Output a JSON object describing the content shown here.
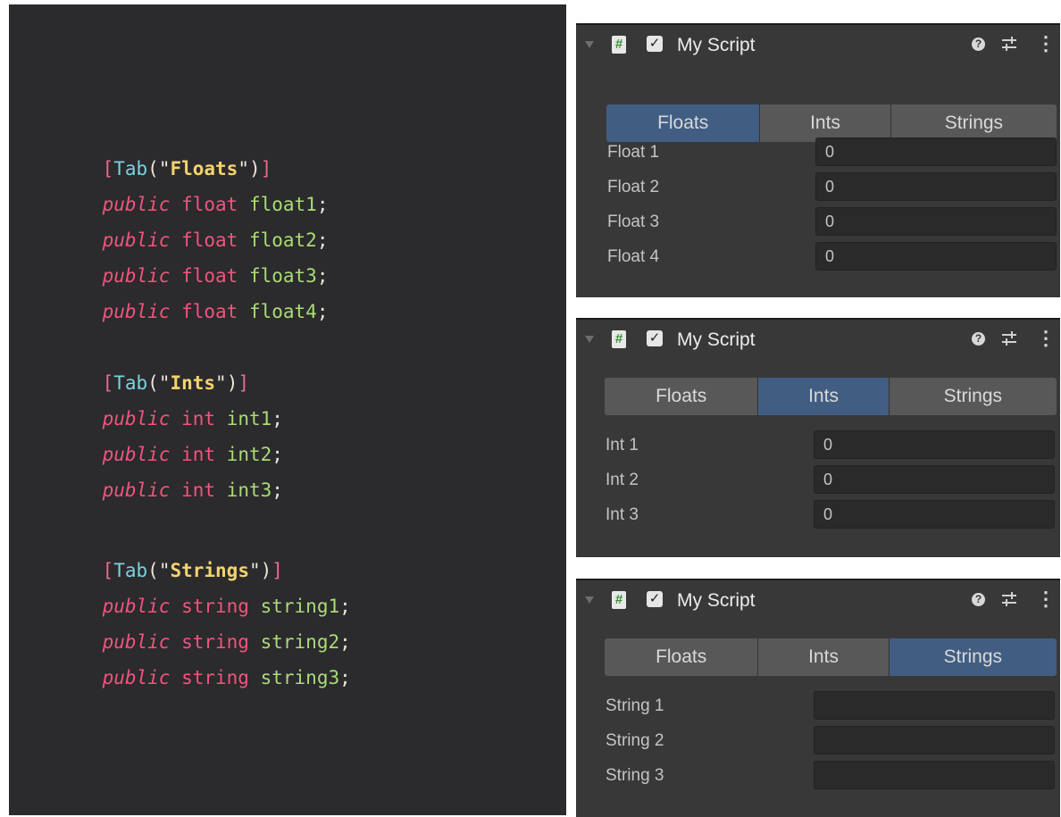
{
  "code": {
    "lines": [
      {
        "bracket_open": "[",
        "attr": "Tab",
        "paren_open": "(\"",
        "string": "Floats",
        "paren_close": "\")",
        "bracket_close": "]"
      },
      {
        "kw": "public",
        "type": "float",
        "name": "float1",
        "semi": ";"
      },
      {
        "kw": "public",
        "type": "float",
        "name": "float2",
        "semi": ";"
      },
      {
        "kw": "public",
        "type": "float",
        "name": "float3",
        "semi": ";"
      },
      {
        "kw": "public",
        "type": "float",
        "name": "float4",
        "semi": ";"
      },
      {
        "bracket_open": "[",
        "attr": "Tab",
        "paren_open": "(\"",
        "string": "Ints",
        "paren_close": "\")",
        "bracket_close": "]"
      },
      {
        "kw": "public",
        "type": "int",
        "name": "int1",
        "semi": ";"
      },
      {
        "kw": "public",
        "type": "int",
        "name": "int2",
        "semi": ";"
      },
      {
        "kw": "public",
        "type": "int",
        "name": "int3",
        "semi": ";"
      },
      {
        "bracket_open": "[",
        "attr": "Tab",
        "paren_open": "(\"",
        "string": "Strings",
        "paren_close": "\")",
        "bracket_close": "]"
      },
      {
        "kw": "public",
        "type": "string",
        "name": "string1",
        "semi": ";"
      },
      {
        "kw": "public",
        "type": "string",
        "name": "string2",
        "semi": ";"
      },
      {
        "kw": "public",
        "type": "string",
        "name": "string3",
        "semi": ";"
      }
    ]
  },
  "inspectors": [
    {
      "title": "My Script",
      "script_icon": "#",
      "check_icon": "✓",
      "help_icon": "?",
      "menu_icon": "⋮",
      "tabs": [
        "Floats",
        "Ints",
        "Strings"
      ],
      "active_tab": "Floats",
      "fields": [
        {
          "label": "Float 1",
          "value": "0"
        },
        {
          "label": "Float 2",
          "value": "0"
        },
        {
          "label": "Float 3",
          "value": "0"
        },
        {
          "label": "Float 4",
          "value": "0"
        }
      ]
    },
    {
      "title": "My Script",
      "script_icon": "#",
      "check_icon": "✓",
      "help_icon": "?",
      "menu_icon": "⋮",
      "tabs": [
        "Floats",
        "Ints",
        "Strings"
      ],
      "active_tab": "Ints",
      "fields": [
        {
          "label": "Int 1",
          "value": "0"
        },
        {
          "label": "Int 2",
          "value": "0"
        },
        {
          "label": "Int 3",
          "value": "0"
        }
      ]
    },
    {
      "title": "My Script",
      "script_icon": "#",
      "check_icon": "✓",
      "help_icon": "?",
      "menu_icon": "⋮",
      "tabs": [
        "Floats",
        "Ints",
        "Strings"
      ],
      "active_tab": "Strings",
      "fields": [
        {
          "label": "String 1",
          "value": ""
        },
        {
          "label": "String 2",
          "value": ""
        },
        {
          "label": "String 3",
          "value": ""
        }
      ]
    }
  ],
  "colors": {
    "editor_bg": "#2b2a2d",
    "inspector_bg": "#383838",
    "tab_active": "#415e82",
    "tab_inactive": "#585858",
    "keyword": "#f0557c",
    "identifier": "#a9dc76",
    "attribute": "#7ad3df",
    "string": "#f4d36f"
  }
}
